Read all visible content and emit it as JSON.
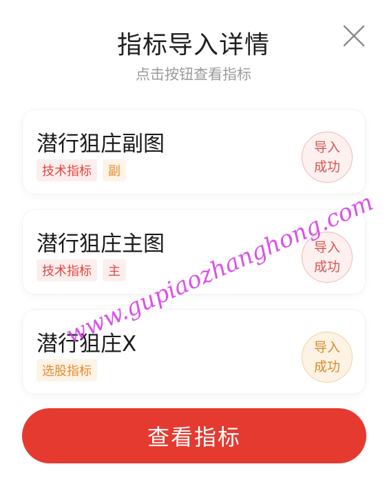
{
  "header": {
    "title": "指标导入详情",
    "subtitle": "点击按钮查看指标",
    "close_icon": "close-icon"
  },
  "items": [
    {
      "name": "潜行狙庄副图",
      "tags": [
        "技术指标",
        "副"
      ],
      "status_line1": "导入",
      "status_line2": "成功"
    },
    {
      "name": "潜行狙庄主图",
      "tags": [
        "技术指标",
        "主"
      ],
      "status_line1": "导入",
      "status_line2": "成功"
    },
    {
      "name": "潜行狙庄X",
      "tags": [
        "选股指标"
      ],
      "status_line1": "导入",
      "status_line2": "成功"
    }
  ],
  "footer": {
    "button_label": "查看指标"
  },
  "watermark": "www.gupiaozhanghong.com",
  "colors": {
    "accent": "#e53a30",
    "tag_red_text": "#e0473f",
    "tag_orange_text": "#e58b2c"
  }
}
